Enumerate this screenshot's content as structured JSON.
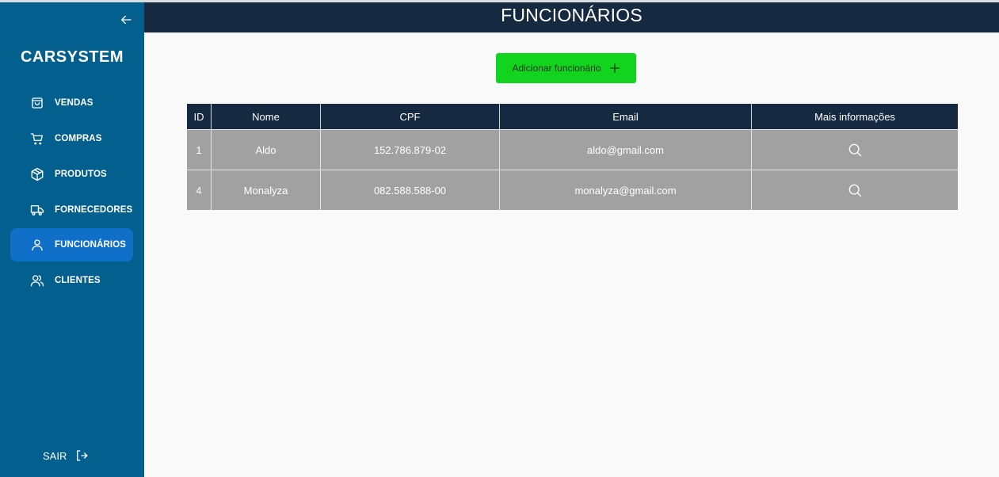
{
  "sidebar": {
    "brand": "CARSYSTEM",
    "items": [
      {
        "label": "VENDAS",
        "icon": "shopping-bag-icon"
      },
      {
        "label": "COMPRAS",
        "icon": "shopping-cart-icon"
      },
      {
        "label": "PRODUTOS",
        "icon": "package-icon"
      },
      {
        "label": "FORNECEDORES",
        "icon": "truck-icon"
      },
      {
        "label": "FUNCIONÁRIOS",
        "icon": "user-icon",
        "active": true
      },
      {
        "label": "CLIENTES",
        "icon": "users-icon"
      }
    ],
    "logout_label": "SAIR",
    "colors": {
      "background": "#035f8e",
      "active": "#0f6fc9"
    }
  },
  "header": {
    "title": "FUNCIONÁRIOS",
    "background": "#152941"
  },
  "add_button": {
    "label": "Adicionar funcionário",
    "color": "#12d41e"
  },
  "table": {
    "columns": [
      "ID",
      "Nome",
      "CPF",
      "Email",
      "Mais informações"
    ],
    "rows": [
      {
        "id": "1",
        "nome": "Aldo",
        "cpf": "152.786.879-02",
        "email": "aldo@gmail.com"
      },
      {
        "id": "4",
        "nome": "Monalyza",
        "cpf": "082.588.588-00",
        "email": "monalyza@gmail.com"
      }
    ]
  }
}
